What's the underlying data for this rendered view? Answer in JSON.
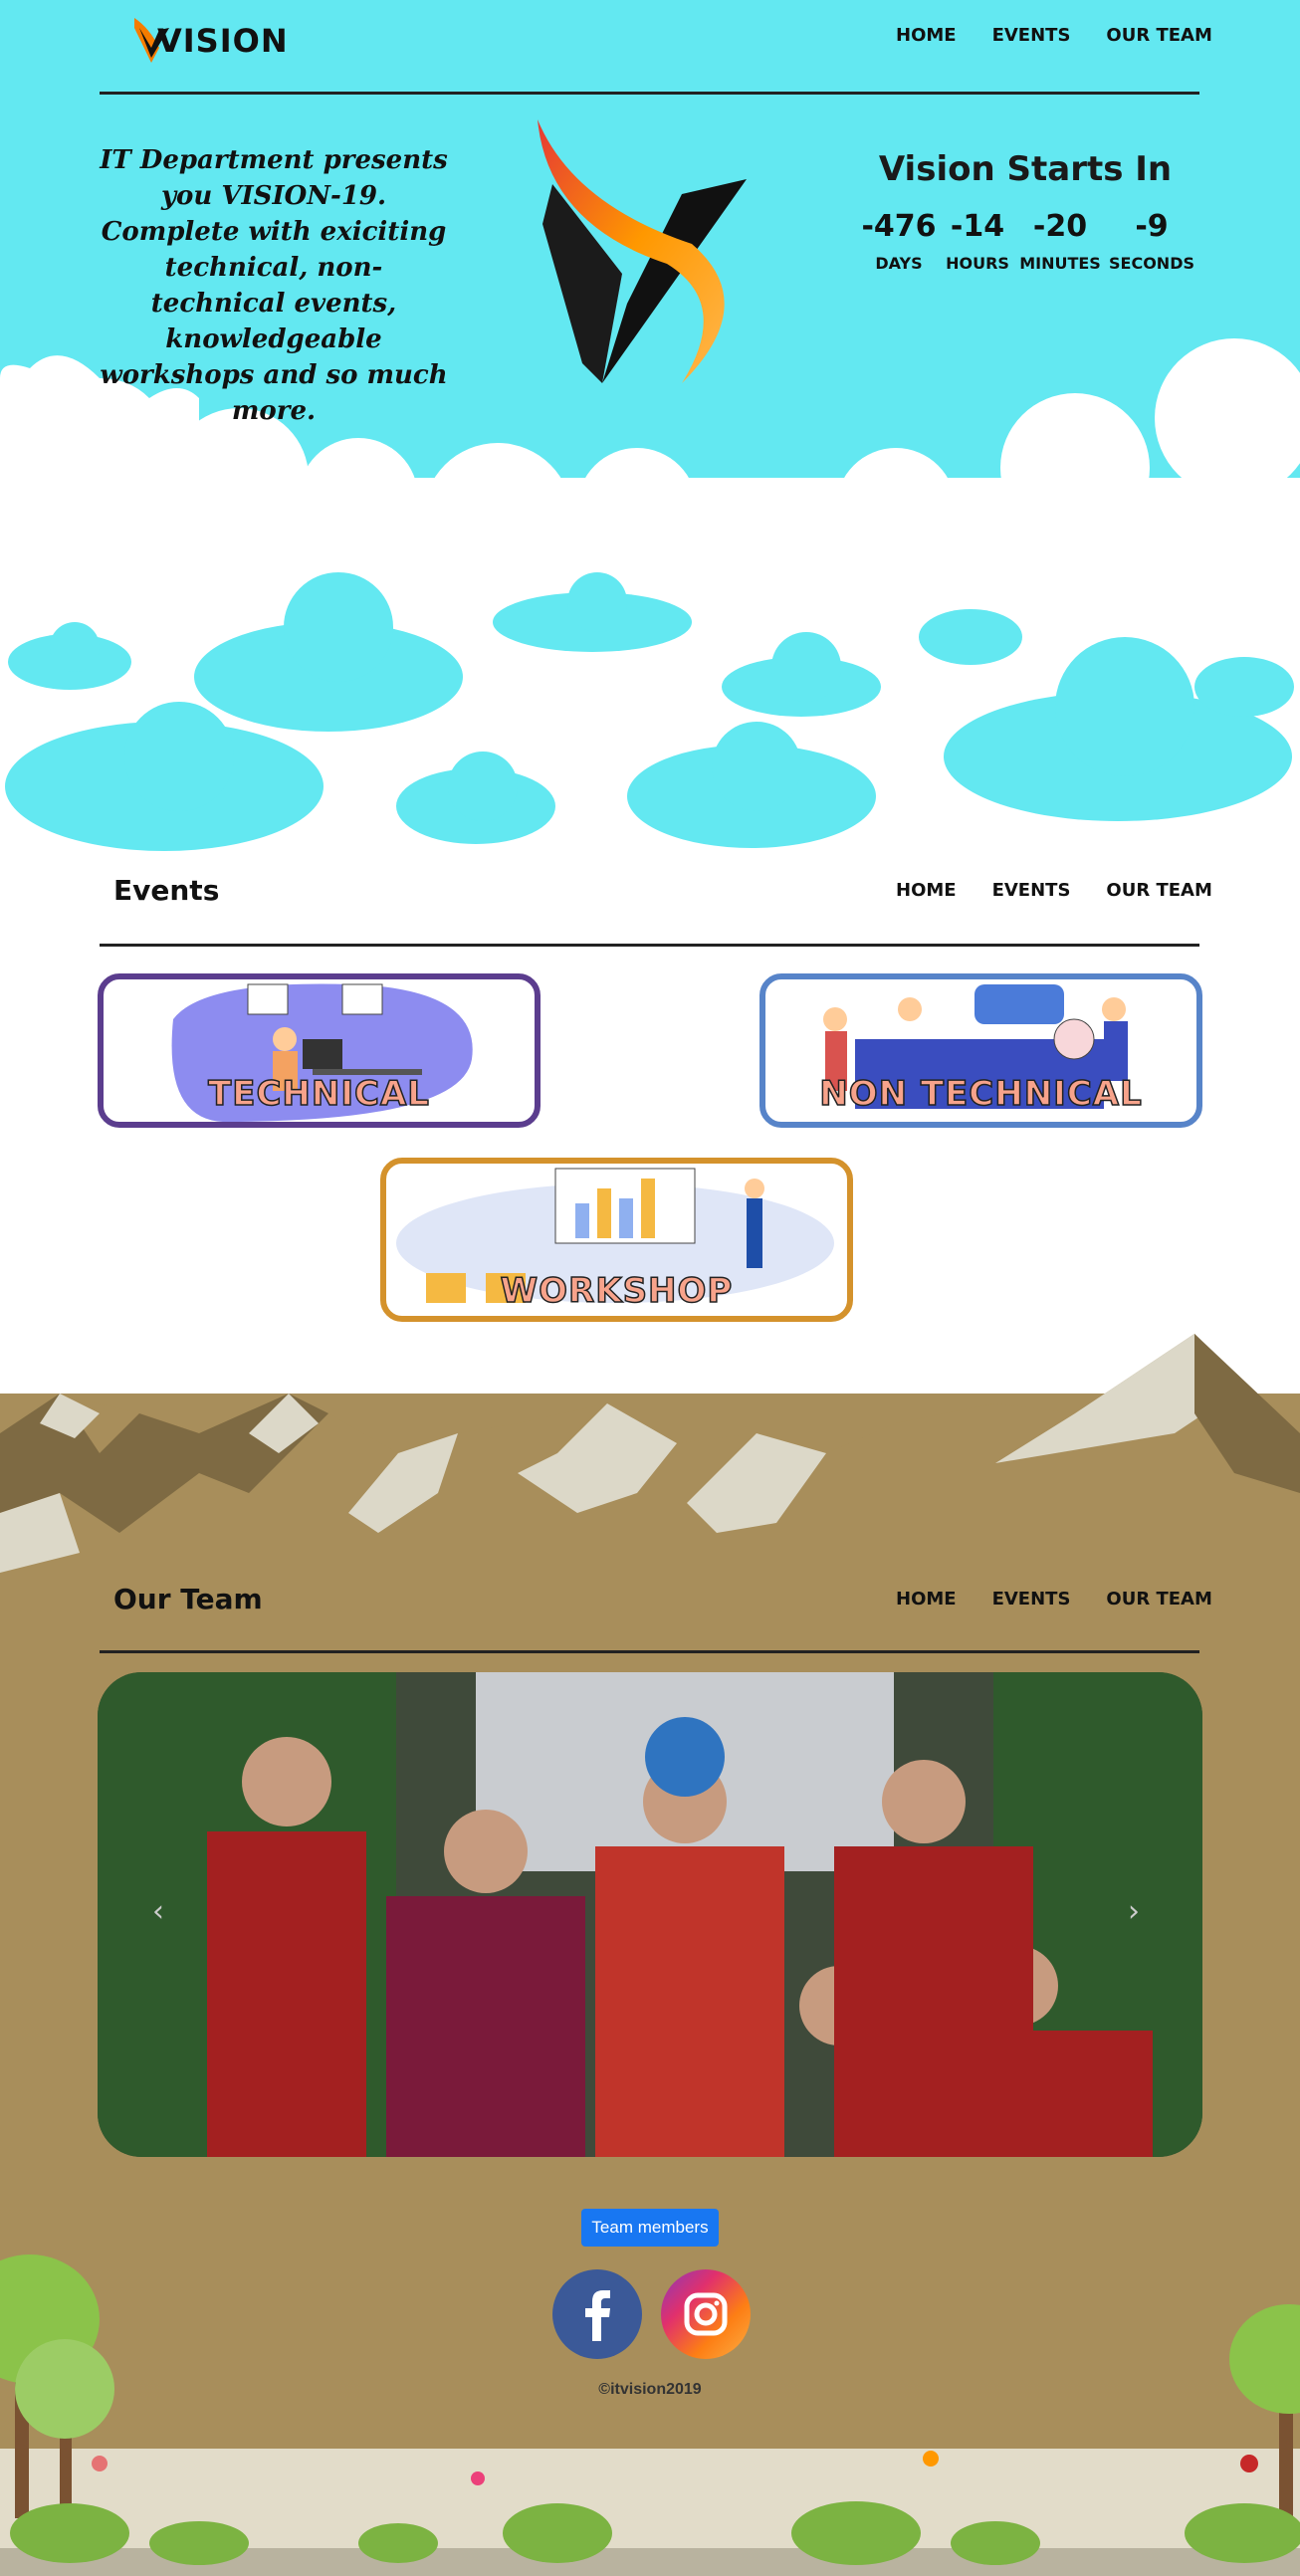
{
  "header": {
    "logo_text": "VISION",
    "nav": [
      "HOME",
      "EVENTS",
      "OUR TEAM"
    ]
  },
  "hero": {
    "tagline": "IT Department presents you VISION-19. Complete with exiciting technical, non-technical events, knowledgeable workshops and so much more.",
    "countdown_title": "Vision Starts In",
    "countdown": [
      {
        "value": "-476",
        "label": "DAYS"
      },
      {
        "value": "-14",
        "label": "HOURS"
      },
      {
        "value": "-20",
        "label": "MINUTES"
      },
      {
        "value": "-9",
        "label": "SECONDS"
      }
    ]
  },
  "events": {
    "title": "Events",
    "nav": [
      "HOME",
      "EVENTS",
      "OUR TEAM"
    ],
    "cards": [
      {
        "label": "TECHNICAL",
        "border": "#5b3d8e"
      },
      {
        "label": "NON TECHNICAL",
        "border": "#5784c9"
      },
      {
        "label": "WORKSHOP",
        "border": "#d4922c"
      }
    ]
  },
  "team": {
    "title": "Our Team",
    "nav": [
      "HOME",
      "EVENTS",
      "OUR TEAM"
    ],
    "button": "Team members"
  },
  "social": {
    "facebook_icon": "facebook-icon",
    "instagram_icon": "instagram-icon"
  },
  "footer": {
    "copyright": "©itvision2019"
  },
  "colors": {
    "sky": "#63e8f1",
    "mountain": "#a88e5b",
    "button": "#1877f2"
  }
}
